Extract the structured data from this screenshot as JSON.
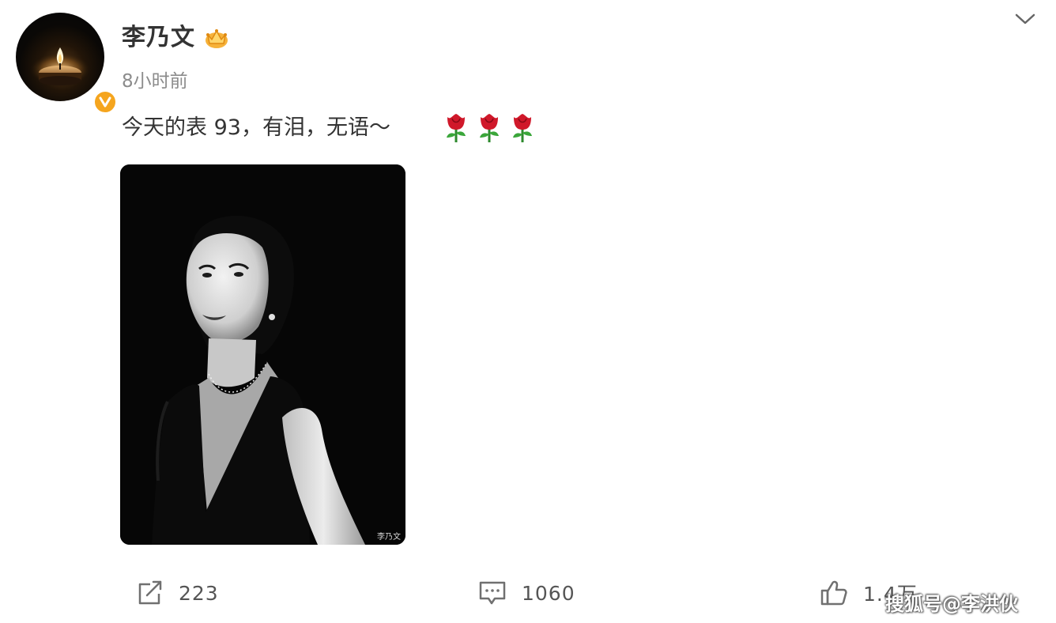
{
  "post": {
    "username": "李乃文",
    "timestamp": "8小时前",
    "content": "今天的表 93，有泪，无语～",
    "emoji_names": [
      "rose-emoji",
      "rose-emoji",
      "rose-emoji"
    ],
    "image": {
      "description_icon": "portrait-photo",
      "watermark": "李乃文"
    }
  },
  "icons": {
    "avatar": "candle-avatar",
    "verified": "verified-v-badge",
    "vip": "crown-icon",
    "menu": "chevron-down-icon",
    "repost": "repost-icon",
    "comment": "comment-icon",
    "like": "thumbs-up-icon"
  },
  "actions": {
    "repost_count": "223",
    "comment_count": "1060",
    "like_count": "1.4万"
  },
  "watermark": {
    "text": "搜狐号@李洪伙"
  },
  "colors": {
    "text": "#333333",
    "muted": "#8c8c8c",
    "badge": "#f5a51e",
    "rose": "#d0182a"
  }
}
